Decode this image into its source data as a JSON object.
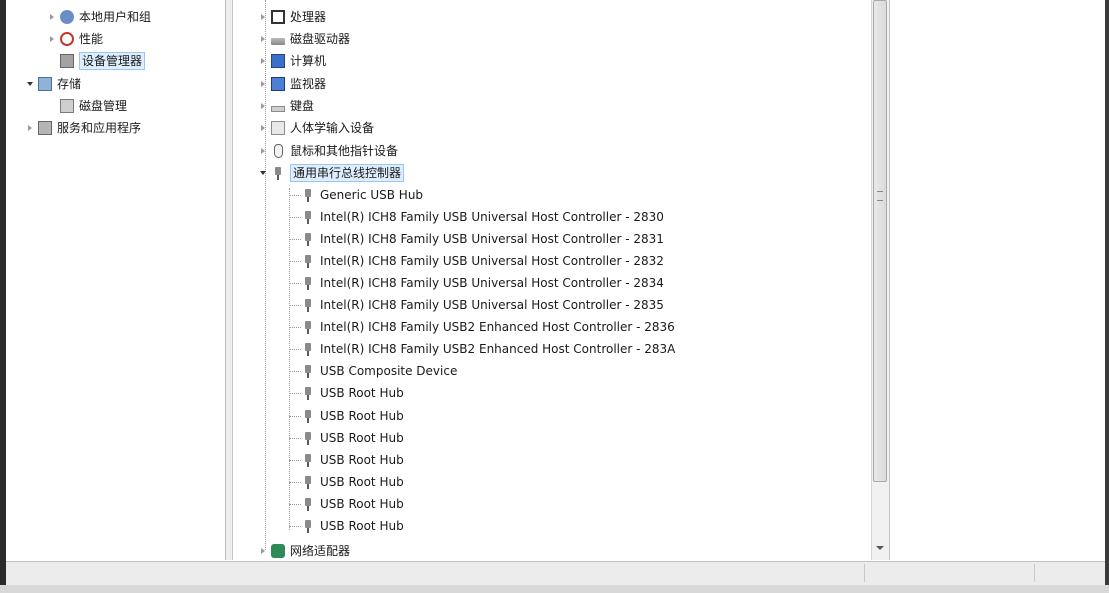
{
  "nav": {
    "items": [
      {
        "label": "本地用户和组",
        "icon": "users-icon",
        "state": "collapsed"
      },
      {
        "label": "性能",
        "icon": "performance-icon",
        "state": "collapsed"
      },
      {
        "label": "设备管理器",
        "icon": "device-manager-icon",
        "state": "selected"
      },
      {
        "label": "存储",
        "icon": "storage-icon",
        "state": "expanded"
      },
      {
        "label": "磁盘管理",
        "icon": "disk-management-icon",
        "state": "leaf"
      },
      {
        "label": "服务和应用程序",
        "icon": "services-icon",
        "state": "collapsed"
      }
    ]
  },
  "tree": {
    "categories": [
      {
        "label": "处理器",
        "icon": "processor-icon"
      },
      {
        "label": "磁盘驱动器",
        "icon": "disk-drive-icon"
      },
      {
        "label": "计算机",
        "icon": "computer-icon"
      },
      {
        "label": "监视器",
        "icon": "monitor-icon"
      },
      {
        "label": "键盘",
        "icon": "keyboard-icon"
      },
      {
        "label": "人体学输入设备",
        "icon": "hid-icon"
      },
      {
        "label": "鼠标和其他指针设备",
        "icon": "mouse-icon"
      }
    ],
    "usb_category": {
      "label": "通用串行总线控制器",
      "icon": "usb-icon",
      "state": "expanded"
    },
    "usb_devices": [
      "Generic USB Hub",
      "Intel(R) ICH8 Family USB Universal Host Controller - 2830",
      "Intel(R) ICH8 Family USB Universal Host Controller - 2831",
      "Intel(R) ICH8 Family USB Universal Host Controller - 2832",
      "Intel(R) ICH8 Family USB Universal Host Controller - 2834",
      "Intel(R) ICH8 Family USB Universal Host Controller - 2835",
      "Intel(R) ICH8 Family USB2 Enhanced Host Controller - 2836",
      "Intel(R) ICH8 Family USB2 Enhanced Host Controller - 283A",
      "USB Composite Device",
      "USB Root Hub",
      "USB Root Hub",
      "USB Root Hub",
      "USB Root Hub",
      "USB Root Hub",
      "USB Root Hub",
      "USB Root Hub"
    ],
    "last_category": {
      "label": "网络适配器",
      "icon": "network-adapter-icon"
    }
  },
  "colors": {
    "selection_bg": "#dfeeff",
    "selection_border": "#9cc6f2",
    "statusbar_bg": "#ececec"
  }
}
